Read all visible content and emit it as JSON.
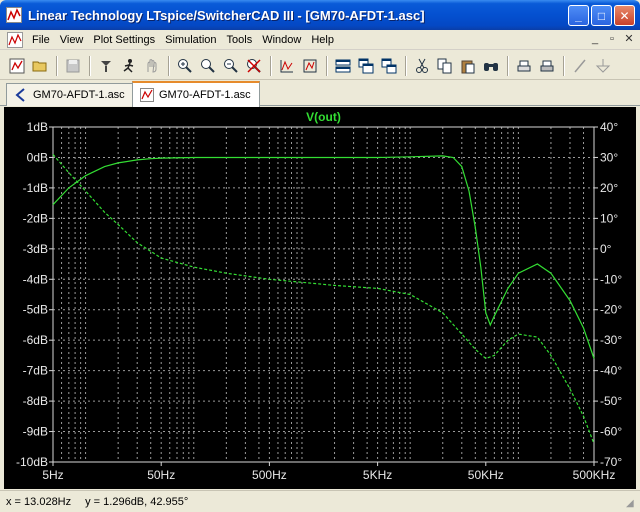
{
  "window": {
    "title": "Linear Technology LTspice/SwitcherCAD III - [GM70-AFDT-1.asc]",
    "controls": [
      "_",
      "□",
      "✕"
    ]
  },
  "menu": {
    "items": [
      "File",
      "View",
      "Plot Settings",
      "Simulation",
      "Tools",
      "Window",
      "Help"
    ],
    "mdi": [
      "_",
      "▫",
      "✕"
    ]
  },
  "toolbar": {
    "icons": [
      "new-schematic-icon",
      "open-icon",
      "save-icon",
      "control-panel-icon",
      "run-icon",
      "halt-icon",
      "zoom-in-icon",
      "zoom-box-icon",
      "zoom-out-icon",
      "zoom-cancel-icon",
      "autorange-icon",
      "mark-icon",
      "tile-horizontal-icon",
      "cascade-icon",
      "tile-vertical-icon",
      "cut-icon",
      "copy-icon",
      "paste-icon",
      "find-icon",
      "print-preview-icon",
      "print-icon",
      "draw-line-icon",
      "ground-icon"
    ]
  },
  "tabs": [
    {
      "label": "GM70-AFDT-1.asc",
      "active": false
    },
    {
      "label": "GM70-AFDT-1.asc",
      "active": true
    }
  ],
  "plot": {
    "trace_name": "V(out)",
    "trace_color": "#33dd33",
    "left_ticks": [
      "1dB",
      "0dB",
      "-1dB",
      "-2dB",
      "-3dB",
      "-4dB",
      "-5dB",
      "-6dB",
      "-7dB",
      "-8dB",
      "-9dB",
      "-10dB"
    ],
    "right_ticks": [
      "40°",
      "30°",
      "20°",
      "10°",
      "0°",
      "-10°",
      "-20°",
      "-30°",
      "-40°",
      "-50°",
      "-60°",
      "-70°"
    ],
    "x_ticks": [
      "5Hz",
      "50Hz",
      "500Hz",
      "5KHz",
      "50KHz",
      "500KHz"
    ]
  },
  "chart_data": {
    "type": "line",
    "x_scale": "log",
    "xlim": [
      5,
      500000
    ],
    "ylim_left": [
      -10,
      1
    ],
    "ylim_right": [
      -70,
      40
    ],
    "grid": true,
    "series": [
      {
        "name": "V(out)",
        "style": "solid",
        "axis": "left",
        "x": [
          5,
          7,
          10,
          15,
          20,
          30,
          40,
          50,
          100,
          500,
          5000,
          10000,
          20000,
          25000,
          30000,
          35000,
          40000,
          45000,
          50000,
          55000,
          60000,
          80000,
          100000,
          150000,
          200000,
          300000,
          400000,
          500000
        ],
        "y": [
          -1.55,
          -1.0,
          -0.6,
          -0.3,
          -0.18,
          -0.08,
          -0.04,
          -0.02,
          0.0,
          0.0,
          0.0,
          0.02,
          0.05,
          0.0,
          -0.3,
          -1.1,
          -2.3,
          -3.6,
          -5.1,
          -5.5,
          -5.2,
          -4.3,
          -3.8,
          -3.5,
          -3.8,
          -4.7,
          -5.6,
          -6.6
        ]
      },
      {
        "name": "phase",
        "style": "dashed",
        "axis": "right",
        "x": [
          5,
          7,
          10,
          15,
          20,
          30,
          50,
          100,
          200,
          500,
          1000,
          2000,
          5000,
          10000,
          20000,
          30000,
          40000,
          50000,
          60000,
          80000,
          100000,
          150000,
          200000,
          300000,
          400000,
          500000
        ],
        "y": [
          31,
          25,
          19,
          12,
          8,
          2,
          -3,
          -6,
          -8,
          -10,
          -11,
          -12,
          -13,
          -15,
          -21,
          -28,
          -33,
          -36,
          -35,
          -30,
          -28,
          -29,
          -35,
          -46,
          -55,
          -64
        ]
      }
    ]
  },
  "status": {
    "x": "x = 13.028Hz",
    "y": "y = 1.296dB, 42.955°"
  }
}
